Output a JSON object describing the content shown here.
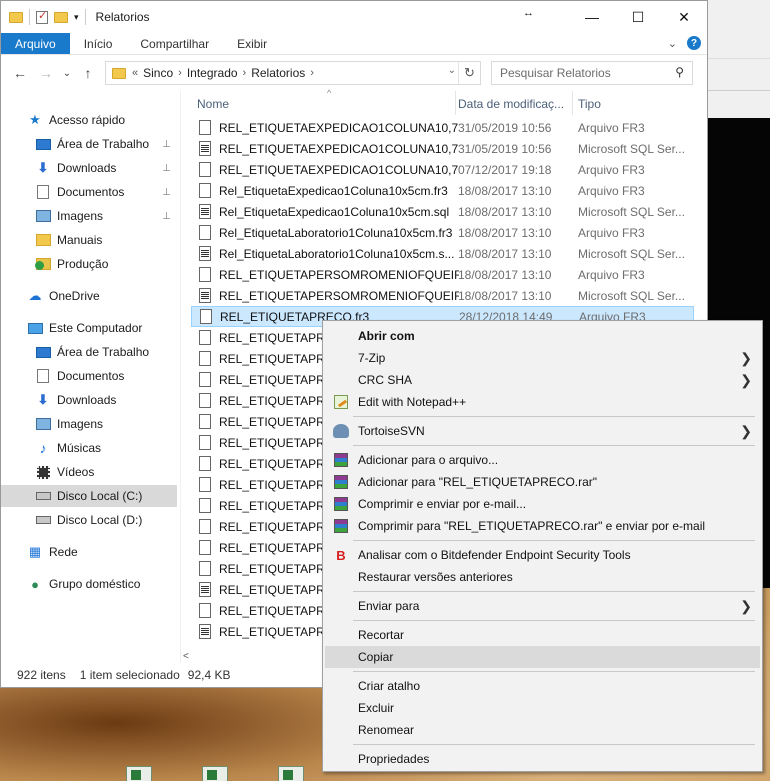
{
  "window": {
    "title": "Relatorios",
    "minimize": "—",
    "maximize": "☐",
    "close": "✕",
    "resize": "↔"
  },
  "ribbon": {
    "tabs": [
      "Arquivo",
      "Início",
      "Compartilhar",
      "Exibir"
    ],
    "expand": "⌄",
    "help": "?"
  },
  "address": {
    "back": "←",
    "forward": "→",
    "recent": "⌄",
    "up": "↑",
    "overflow": "«",
    "crumbs": [
      "Sinco",
      "Integrado",
      "Relatorios"
    ],
    "crumb_sep": "›",
    "dropdown": "⌄",
    "refresh": "↻",
    "search_placeholder": "Pesquisar Relatorios",
    "search_icon": "⚲"
  },
  "nav": {
    "items": [
      {
        "label": "Acesso rápido",
        "icon": "star-icon",
        "pinned": false,
        "indent": 0
      },
      {
        "label": "Área de Trabalho",
        "icon": "desktop-icon",
        "pinned": true,
        "indent": 1
      },
      {
        "label": "Downloads",
        "icon": "download-icon",
        "pinned": true,
        "indent": 1
      },
      {
        "label": "Documentos",
        "icon": "documents-icon",
        "pinned": true,
        "indent": 1
      },
      {
        "label": "Imagens",
        "icon": "pictures-icon",
        "pinned": true,
        "indent": 1
      },
      {
        "label": "Manuais",
        "icon": "folder-icon",
        "pinned": false,
        "indent": 1
      },
      {
        "label": "Produção",
        "icon": "folder-check-icon",
        "pinned": false,
        "indent": 1
      },
      {
        "label": "OneDrive",
        "icon": "cloud-icon",
        "pinned": false,
        "indent": 0
      },
      {
        "label": "Este Computador",
        "icon": "computer-icon",
        "pinned": false,
        "indent": 0
      },
      {
        "label": "Área de Trabalho",
        "icon": "desktop-icon",
        "pinned": false,
        "indent": 1
      },
      {
        "label": "Documentos",
        "icon": "documents-icon",
        "pinned": false,
        "indent": 1
      },
      {
        "label": "Downloads",
        "icon": "download-icon",
        "pinned": false,
        "indent": 1
      },
      {
        "label": "Imagens",
        "icon": "pictures-icon",
        "pinned": false,
        "indent": 1
      },
      {
        "label": "Músicas",
        "icon": "music-icon",
        "pinned": false,
        "indent": 1
      },
      {
        "label": "Vídeos",
        "icon": "video-icon",
        "pinned": false,
        "indent": 1
      },
      {
        "label": "Disco Local (C:)",
        "icon": "drive-icon",
        "pinned": false,
        "indent": 1,
        "selected": true
      },
      {
        "label": "Disco Local (D:)",
        "icon": "drive-icon",
        "pinned": false,
        "indent": 1
      },
      {
        "label": "Rede",
        "icon": "network-icon",
        "pinned": false,
        "indent": 0
      },
      {
        "label": "Grupo doméstico",
        "icon": "homegroup-icon",
        "pinned": false,
        "indent": 0
      }
    ],
    "pin_glyph": "📌"
  },
  "columns": {
    "name": "Nome",
    "date": "Data de modificaç...",
    "type": "Tipo",
    "sort_glyph": "^"
  },
  "files": [
    {
      "name": "REL_ETIQUETAEXPEDICAO1COLUNA10,7...",
      "date": "31/05/2019 10:56",
      "type": "Arquivo FR3",
      "kind": "fr3"
    },
    {
      "name": "REL_ETIQUETAEXPEDICAO1COLUNA10,7...",
      "date": "31/05/2019 10:56",
      "type": "Microsoft SQL Ser...",
      "kind": "sql"
    },
    {
      "name": "REL_ETIQUETAEXPEDICAO1COLUNA10,7...",
      "date": "07/12/2017 19:18",
      "type": "Arquivo FR3",
      "kind": "fr3"
    },
    {
      "name": "Rel_EtiquetaExpedicao1Coluna10x5cm.fr3",
      "date": "18/08/2017 13:10",
      "type": "Arquivo FR3",
      "kind": "fr3"
    },
    {
      "name": "Rel_EtiquetaExpedicao1Coluna10x5cm.sql",
      "date": "18/08/2017 13:10",
      "type": "Microsoft SQL Ser...",
      "kind": "sql"
    },
    {
      "name": "Rel_EtiquetaLaboratorio1Coluna10x5cm.fr3",
      "date": "18/08/2017 13:10",
      "type": "Arquivo FR3",
      "kind": "fr3"
    },
    {
      "name": "Rel_EtiquetaLaboratorio1Coluna10x5cm.s...",
      "date": "18/08/2017 13:10",
      "type": "Microsoft SQL Ser...",
      "kind": "sql"
    },
    {
      "name": "REL_ETIQUETAPERSOMROMENIOFQUEIR...",
      "date": "18/08/2017 13:10",
      "type": "Arquivo FR3",
      "kind": "fr3"
    },
    {
      "name": "REL_ETIQUETAPERSOMROMENIOFQUEIR...",
      "date": "18/08/2017 13:10",
      "type": "Microsoft SQL Ser...",
      "kind": "sql"
    },
    {
      "name": "REL_ETIQUETAPRECO.fr3",
      "date": "28/12/2018 14:49",
      "type": "Arquivo FR3",
      "kind": "fr3",
      "selected": true
    },
    {
      "name": "REL_ETIQUETAPREC",
      "date": "",
      "type": "",
      "kind": "fr3"
    },
    {
      "name": "REL_ETIQUETAPREC",
      "date": "",
      "type": "",
      "kind": "fr3"
    },
    {
      "name": "REL_ETIQUETAPREC",
      "date": "",
      "type": "",
      "kind": "fr3"
    },
    {
      "name": "REL_ETIQUETAPREC",
      "date": "",
      "type": "",
      "kind": "fr3"
    },
    {
      "name": "REL_ETIQUETAPREC",
      "date": "",
      "type": "",
      "kind": "fr3"
    },
    {
      "name": "REL_ETIQUETAPREC",
      "date": "",
      "type": "",
      "kind": "fr3"
    },
    {
      "name": "REL_ETIQUETAPREC",
      "date": "",
      "type": "",
      "kind": "fr3"
    },
    {
      "name": "REL_ETIQUETAPREC",
      "date": "",
      "type": "",
      "kind": "fr3"
    },
    {
      "name": "REL_ETIQUETAPREC",
      "date": "",
      "type": "",
      "kind": "fr3"
    },
    {
      "name": "REL_ETIQUETAPREC",
      "date": "",
      "type": "",
      "kind": "fr3"
    },
    {
      "name": "REL_ETIQUETAPREC",
      "date": "",
      "type": "",
      "kind": "fr3"
    },
    {
      "name": "REL_ETIQUETAPROD",
      "date": "",
      "type": "",
      "kind": "fr3"
    },
    {
      "name": "REL_ETIQUETAPROD",
      "date": "",
      "type": "",
      "kind": "sql"
    },
    {
      "name": "REL_ETIQUETAPROD",
      "date": "",
      "type": "",
      "kind": "fr3"
    },
    {
      "name": "REL_ETIQUETAPROD",
      "date": "",
      "type": "",
      "kind": "sql"
    }
  ],
  "hscroll_left": "<",
  "status": {
    "count": "922 itens",
    "selected": "1 item selecionado",
    "size": "92,4 KB"
  },
  "context_menu": {
    "items": [
      {
        "label": "Abrir com",
        "bold": true,
        "icon": "",
        "submenu": false
      },
      {
        "label": "7-Zip",
        "icon": "",
        "submenu": true
      },
      {
        "label": "CRC SHA",
        "icon": "",
        "submenu": true
      },
      {
        "label": "Edit with Notepad++",
        "icon": "notepadpp-icon",
        "submenu": false
      },
      {
        "sep": true
      },
      {
        "label": "TortoiseSVN",
        "icon": "tortoisesvn-icon",
        "submenu": true
      },
      {
        "sep": true
      },
      {
        "label": "Adicionar para o arquivo...",
        "icon": "winrar-icon",
        "submenu": false
      },
      {
        "label": "Adicionar para \"REL_ETIQUETAPRECO.rar\"",
        "icon": "winrar-icon",
        "submenu": false
      },
      {
        "label": "Comprimir e enviar por e-mail...",
        "icon": "winrar-icon",
        "submenu": false
      },
      {
        "label": "Comprimir para \"REL_ETIQUETAPRECO.rar\" e enviar por e-mail",
        "icon": "winrar-icon",
        "submenu": false
      },
      {
        "sep": true
      },
      {
        "label": "Analisar com o Bitdefender Endpoint Security Tools",
        "icon": "bitdefender-icon",
        "submenu": false
      },
      {
        "label": "Restaurar versões anteriores",
        "icon": "",
        "submenu": false
      },
      {
        "sep": true
      },
      {
        "label": "Enviar para",
        "icon": "",
        "submenu": true
      },
      {
        "sep": true
      },
      {
        "label": "Recortar",
        "icon": "",
        "submenu": false
      },
      {
        "label": "Copiar",
        "icon": "",
        "submenu": false,
        "highlighted": true
      },
      {
        "sep": true
      },
      {
        "label": "Criar atalho",
        "icon": "",
        "submenu": false
      },
      {
        "label": "Excluir",
        "icon": "",
        "submenu": false
      },
      {
        "label": "Renomear",
        "icon": "",
        "submenu": false
      },
      {
        "sep": true
      },
      {
        "label": "Propriedades",
        "icon": "",
        "submenu": false
      }
    ],
    "arrow_glyph": "❯",
    "bitdefender_glyph": "B"
  }
}
